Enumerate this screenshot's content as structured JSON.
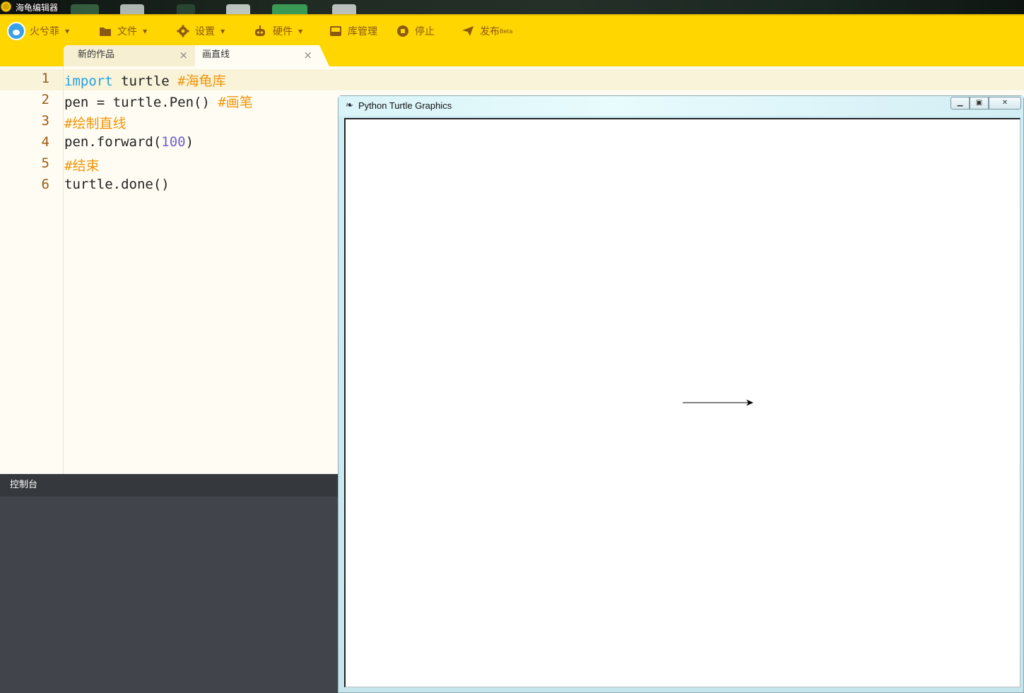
{
  "os_window": {
    "title": "海龟编辑器"
  },
  "toolbar": {
    "user": "火兮菲",
    "file": "文件",
    "settings": "设置",
    "hardware": "硬件",
    "library": "库管理",
    "stop": "停止",
    "publish": "发布",
    "publish_badge": "Beta"
  },
  "tabs": [
    {
      "label": "新的作品",
      "close": "×"
    },
    {
      "label": "画直线",
      "close": "×"
    }
  ],
  "editor": {
    "line_numbers": [
      "1",
      "2",
      "3",
      "4",
      "5",
      "6"
    ],
    "lines": [
      [
        {
          "t": "import",
          "c": "kw"
        },
        {
          "t": " turtle ",
          "c": ""
        },
        {
          "t": "#海龟库",
          "c": "cm"
        }
      ],
      [
        {
          "t": "pen = turtle.Pen() ",
          "c": ""
        },
        {
          "t": "#画笔",
          "c": "cm"
        }
      ],
      [
        {
          "t": "#绘制直线",
          "c": "cm"
        }
      ],
      [
        {
          "t": "pen.forward(",
          "c": ""
        },
        {
          "t": "100",
          "c": "num"
        },
        {
          "t": ")",
          "c": ""
        }
      ],
      [
        {
          "t": "#结束",
          "c": "cm"
        }
      ],
      [
        {
          "t": "turtle.done()",
          "c": ""
        }
      ]
    ]
  },
  "console": {
    "title": "控制台"
  },
  "turtle_window": {
    "title": "Python Turtle Graphics",
    "min_icon": "minimize-icon",
    "max_icon": "restore-icon",
    "close_icon": "close-icon",
    "drawing": {
      "command": "forward",
      "distance": 100,
      "heading_deg": 0,
      "pen_color": "#000000"
    }
  },
  "colors": {
    "toolbar_bg": "#ffd600",
    "toolbar_text": "#8a5a14",
    "editor_bg": "#fffdf3",
    "keyword": "#2aa1e0",
    "comment": "#f0960a",
    "number": "#6f5fd0",
    "console_bg": "#41454b"
  }
}
